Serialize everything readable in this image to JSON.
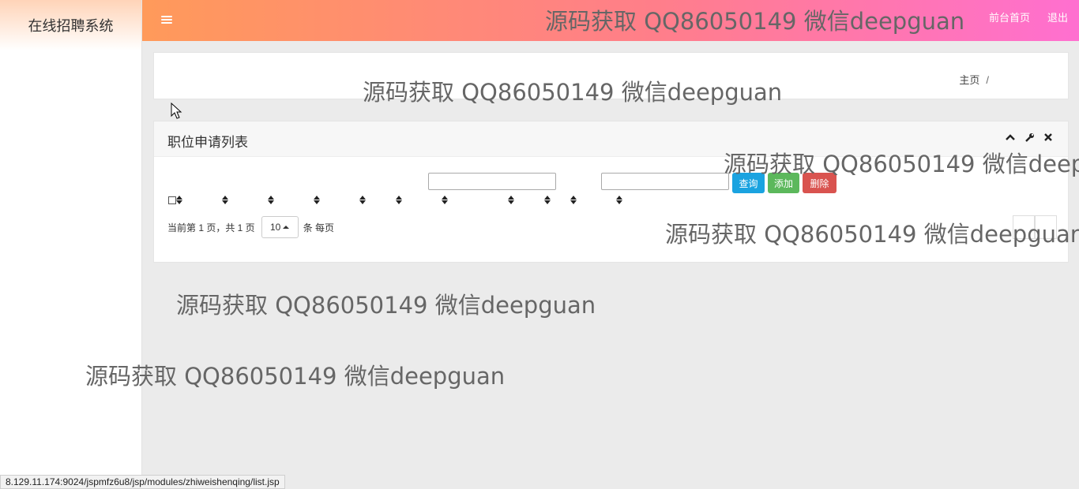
{
  "sidebar": {
    "brand": "在线招聘系统"
  },
  "topbar": {
    "menu_icon": "hamburger-menu-icon",
    "links": [
      "前台首页",
      "退出"
    ],
    "gradient": [
      "#ff9a5a",
      "#ff6fd0"
    ]
  },
  "breadcrumb": {
    "home": "主页",
    "separator": "/"
  },
  "panel": {
    "title": "职位申请列表",
    "tools": [
      "chevron-up-icon",
      "wrench-icon",
      "close-icon"
    ],
    "search_inputs": [
      {
        "value": ""
      },
      {
        "value": ""
      }
    ],
    "buttons": {
      "query": {
        "label": "查询",
        "color": "#1aa3e0"
      },
      "add": {
        "label": "添加",
        "color": "#5cb85c"
      },
      "delete": {
        "label": "删除",
        "color": "#d9534f"
      }
    }
  },
  "pagination": {
    "prefix": "当前第 1 页，共 1 页",
    "page_size": "10",
    "suffix": "条 每页"
  },
  "watermark_text": "源码获取 QQ86050149 微信deepguan",
  "statusbar": {
    "url": "8.129.11.174:9024/jspmfz6u8/jsp/modules/zhiweishenqing/list.jsp"
  }
}
